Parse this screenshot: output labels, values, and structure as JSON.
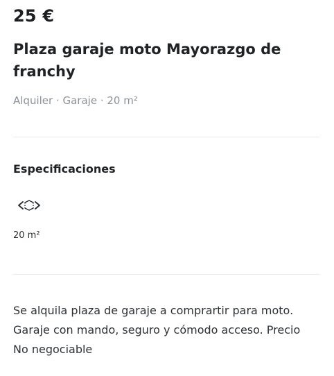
{
  "listing": {
    "price": "25 €",
    "title": "Plaza garaje moto Mayorazgo de franchy",
    "meta": "Alquiler · Garaje · 20 m²"
  },
  "specifications": {
    "heading": "Especificaciones",
    "icon": "area-size-icon",
    "value": "20 m²"
  },
  "description": {
    "text": "Se alquila plaza de garaje a comprartir para moto. Garaje con mando, seguro y cómodo acceso. Precio No negociable"
  }
}
